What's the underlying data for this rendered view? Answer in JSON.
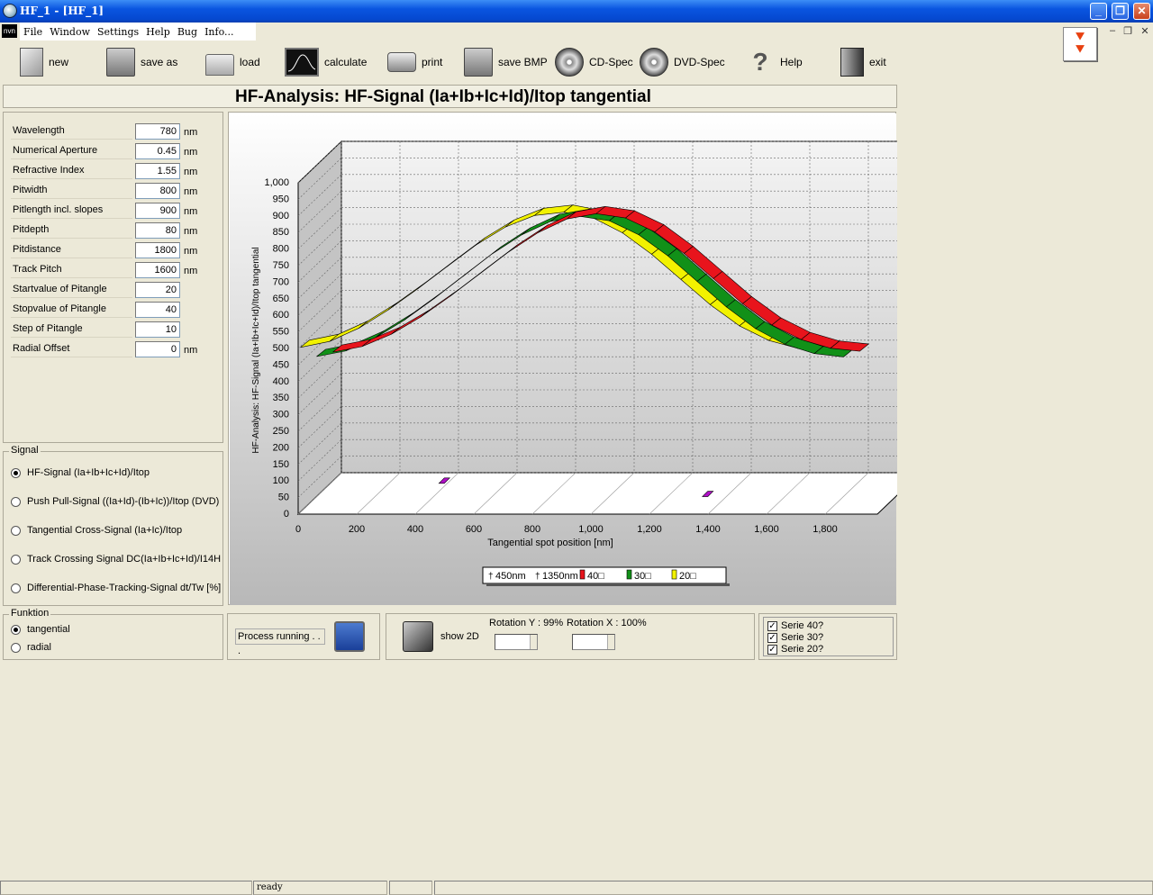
{
  "window": {
    "title": "HF_1 - [HF_1]"
  },
  "menu": {
    "mdi_label": "nvn",
    "items": [
      "File",
      "Window",
      "Settings",
      "Help",
      "Bug",
      "Info..."
    ]
  },
  "toolbar": {
    "new": "new",
    "save_as": "save as",
    "load": "load",
    "calculate": "calculate",
    "print": "print",
    "save_bmp": "save BMP",
    "cd_spec": "CD-Spec",
    "dvd_spec": "DVD-Spec",
    "help": "Help",
    "exit": "exit"
  },
  "chart_title": "HF-Analysis: HF-Signal (Ia+Ib+Ic+Id)/Itop tangential",
  "parameters": [
    {
      "label": "Wavelength",
      "value": "780",
      "unit": "nm"
    },
    {
      "label": "Numerical Aperture",
      "value": "0.45",
      "unit": "nm"
    },
    {
      "label": "Refractive Index",
      "value": "1.55",
      "unit": "nm"
    },
    {
      "label": "Pitwidth",
      "value": "800",
      "unit": "nm"
    },
    {
      "label": "Pitlength incl. slopes",
      "value": "900",
      "unit": "nm"
    },
    {
      "label": "Pitdepth",
      "value": "80",
      "unit": "nm"
    },
    {
      "label": "Pitdistance",
      "value": "1800",
      "unit": "nm"
    },
    {
      "label": "Track Pitch",
      "value": "1600",
      "unit": "nm"
    },
    {
      "label": "Startvalue of Pitangle",
      "value": "20",
      "unit": ""
    },
    {
      "label": "Stopvalue of Pitangle",
      "value": "40",
      "unit": ""
    },
    {
      "label": "Step of Pitangle",
      "value": "10",
      "unit": ""
    },
    {
      "label": "Radial Offset",
      "value": "0",
      "unit": "nm"
    }
  ],
  "signal": {
    "title": "Signal",
    "options": [
      "HF-Signal (Ia+Ib+Ic+Id)/Itop",
      "Push Pull-Signal ((Ia+Id)-(Ib+Ic))/Itop (DVD)",
      "Tangential Cross-Signal (Ia+Ic)/Itop",
      "Track Crossing Signal DC(Ia+Ib+Ic+Id)/I14H",
      "Differential-Phase-Tracking-Signal dt/Tw [%]"
    ],
    "selected": 0
  },
  "funktion": {
    "title": "Funktion",
    "options": [
      "tangential",
      "radial"
    ],
    "selected": 0
  },
  "process": {
    "label": "Process running . . ."
  },
  "rotation": {
    "show2d": "show 2D",
    "y_label": "Rotation Y : 99%",
    "x_label": "Rotation X : 100%"
  },
  "series_checks": [
    "Serie 40?",
    "Serie 30?",
    "Serie 20?"
  ],
  "status": {
    "text": "ready"
  },
  "colors": {
    "series40": "#e8141c",
    "series30": "#119018",
    "series20": "#f2f200",
    "marker": "#b010c8"
  },
  "chart_data": {
    "type": "line",
    "title": "",
    "xlabel": "Tangential spot position [nm]",
    "ylabel": "HF-Analysis: HF-Signal (Ia+Ib+Ic+Id)/Itop tangential",
    "xlim": [
      0,
      1800
    ],
    "ylim": [
      0,
      1000
    ],
    "x_ticks": [
      "0",
      "200",
      "400",
      "600",
      "800",
      "1,000",
      "1,200",
      "1,400",
      "1,600",
      "1,800"
    ],
    "y_ticks": [
      "0",
      "50",
      "100",
      "150",
      "200",
      "250",
      "300",
      "350",
      "400",
      "450",
      "500",
      "550",
      "600",
      "650",
      "700",
      "750",
      "800",
      "850",
      "900",
      "950",
      "1,000"
    ],
    "x": [
      0,
      100,
      200,
      300,
      400,
      500,
      600,
      700,
      800,
      900,
      1000,
      1100,
      1200,
      1300,
      1400,
      1500,
      1600,
      1700,
      1800
    ],
    "series": [
      {
        "name": "40□",
        "values": [
          420,
          437,
          474,
          526,
          588,
          655,
          722,
          780,
          822,
          838,
          825,
          783,
          718,
          642,
          566,
          502,
          458,
          432,
          423
        ]
      },
      {
        "name": "30□",
        "values": [
          438,
          455,
          494,
          548,
          612,
          680,
          748,
          805,
          846,
          861,
          848,
          806,
          742,
          665,
          588,
          522,
          475,
          447,
          437
        ]
      },
      {
        "name": "20□",
        "values": [
          497,
          515,
          555,
          610,
          673,
          740,
          806,
          860,
          895,
          905,
          888,
          843,
          778,
          702,
          626,
          562,
          518,
          494,
          487
        ]
      }
    ],
    "markers": [
      {
        "name": "450nm",
        "x": 450,
        "y": 120
      },
      {
        "name": "1350nm",
        "x": 1350,
        "y": 80
      }
    ],
    "legend": [
      "450nm",
      "1350nm",
      "40□",
      "30□",
      "20□"
    ],
    "legend_position": "bottom",
    "grid": true
  }
}
